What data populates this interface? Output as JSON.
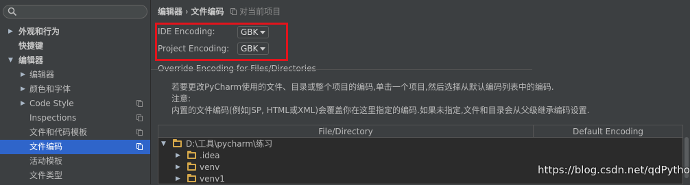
{
  "sidebar": {
    "search_placeholder": "",
    "items": [
      {
        "label": "外观和行为",
        "arrow": "▶",
        "bold": true
      },
      {
        "label": "快捷键",
        "arrow": "",
        "bold": true
      },
      {
        "label": "编辑器",
        "arrow": "▼",
        "bold": true
      },
      {
        "label": "编辑器",
        "arrow": "▶",
        "bold": false
      },
      {
        "label": "颜色和字体",
        "arrow": "▶",
        "bold": false
      },
      {
        "label": "Code Style",
        "arrow": "▶",
        "bold": false
      },
      {
        "label": "Inspections",
        "arrow": "",
        "bold": false
      },
      {
        "label": "文件和代码模板",
        "arrow": "",
        "bold": false
      },
      {
        "label": "文件编码",
        "arrow": "",
        "bold": false,
        "selected": true
      },
      {
        "label": "活动模板",
        "arrow": "",
        "bold": false
      },
      {
        "label": "文件类型",
        "arrow": "",
        "bold": false
      }
    ]
  },
  "breadcrumb": {
    "parent": "编辑器",
    "separator": "›",
    "current": "文件编码",
    "scope": "对当前项目"
  },
  "settings": {
    "ide_encoding_label": "IDE Encoding:",
    "ide_encoding_value": "GBK",
    "project_encoding_label": "Project Encoding:",
    "project_encoding_value": "GBK"
  },
  "override": {
    "title": "Override Encoding for Files/Directories",
    "line1": "若要更改PyCharm使用的文件、目录或整个项目的编码,单击一个项目,然后选择从默认编码列表中的编码.",
    "line2": "注意:",
    "line3": "内置的文件编码(例如JSP, HTML或XML)会覆盖你在这里指定的编码.如果未指定,文件和目录会从父级继承编码设置."
  },
  "table": {
    "col_file": "File/Directory",
    "col_encoding": "Default Encoding",
    "rows": [
      {
        "name": "D:\\工具\\pycharm\\练习",
        "arrow": "▼"
      },
      {
        "name": ".idea",
        "arrow": "▶"
      },
      {
        "name": "venv",
        "arrow": "▶"
      },
      {
        "name": "venv1",
        "arrow": "▶"
      }
    ]
  },
  "watermark": "https://blog.csdn.net/qdPython",
  "colors": {
    "selection": "#2f65ca",
    "highlight_box": "#e3141c",
    "folder": "#d6a84a"
  }
}
